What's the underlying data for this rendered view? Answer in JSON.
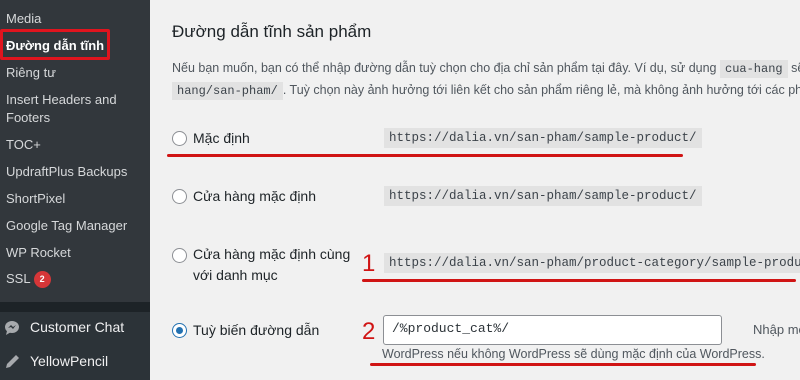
{
  "sidebar": {
    "items": [
      {
        "label": "Media"
      },
      {
        "label": "Đường dẫn tĩnh"
      },
      {
        "label": "Riêng tư"
      },
      {
        "label": "Insert Headers and"
      },
      {
        "label": "Footers"
      },
      {
        "label": "TOC+"
      },
      {
        "label": "UpdraftPlus Backups"
      },
      {
        "label": "ShortPixel"
      },
      {
        "label": "Google Tag Manager"
      },
      {
        "label": "WP Rocket"
      },
      {
        "label": "SSL"
      }
    ],
    "ssl_badge": "2",
    "menu": [
      {
        "label": "Customer Chat",
        "icon": "chat-bubble-icon"
      },
      {
        "label": "YellowPencil",
        "icon": "pencil-icon"
      }
    ]
  },
  "main": {
    "title": "Đường dẫn tĩnh sản phẩm",
    "desc_part1": "Nếu bạn muốn, bạn có thể nhập đường dẫn tuỳ chọn cho địa chỉ sản phẩm tại đây. Ví dụ, sử dụng",
    "desc_code1": "cua-hang",
    "desc_part2": "sẽ",
    "desc_code2": "hang/san-pham/",
    "desc_part3": ". Tuỳ chọn này ảnh hưởng tới liên kết cho sản phẩm riêng lẻ, mà không ảnh hưởng tới các phẩm",
    "options": [
      {
        "label": "Mặc định",
        "url": "https://dalia.vn/san-pham/sample-product/",
        "checked": false
      },
      {
        "label": "Cửa hàng mặc định",
        "url": "https://dalia.vn/san-pham/sample-product/",
        "checked": false
      },
      {
        "label_line1": "Cửa hàng mặc định cùng",
        "label_line2": "với danh mục",
        "url": "https://dalia.vn/san-pham/product-category/sample-product/",
        "checked": false
      },
      {
        "label": "Tuỳ biến đường dẫn",
        "checked": true
      }
    ],
    "custom_value": "/%product_cat%/",
    "side_note": "Nhập một m",
    "help_text": "WordPress nếu không WordPress sẽ dùng mặc định của WordPress.",
    "annotation_1": "1",
    "annotation_2": "2",
    "accent_color": "#2271b1",
    "annotation_color": "#d01414"
  }
}
